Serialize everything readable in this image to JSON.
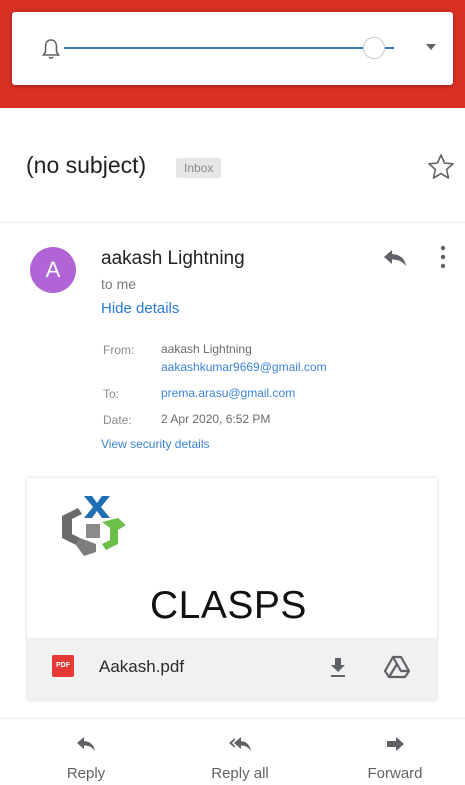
{
  "volume": {
    "level_percent": 94,
    "bell_icon": "bell-icon",
    "chevron_icon": "chevron-down-icon",
    "accent_color": "#3c78c3"
  },
  "header_color": "#d93025",
  "email": {
    "subject": "(no subject)",
    "label": "Inbox",
    "sender_initial": "A",
    "sender_name": "aakash Lightning",
    "to_me": "to me",
    "hide_details": "Hide details",
    "details": {
      "from_label": "From:",
      "from_name": "aakash Lightning",
      "from_email": "aakashkumar9669@gmail.com",
      "to_label": "To:",
      "to_email": "prema.arasu@gmail.com",
      "date_label": "Date:",
      "date_value": "2 Apr 2020, 6:52 PM",
      "view_security": "View security details"
    },
    "body_text": "CLASPS",
    "attachment": {
      "type_badge": "PDF",
      "file_name": "Aakash.pdf"
    }
  },
  "actions": {
    "reply": "Reply",
    "reply_all": "Reply all",
    "forward": "Forward"
  }
}
